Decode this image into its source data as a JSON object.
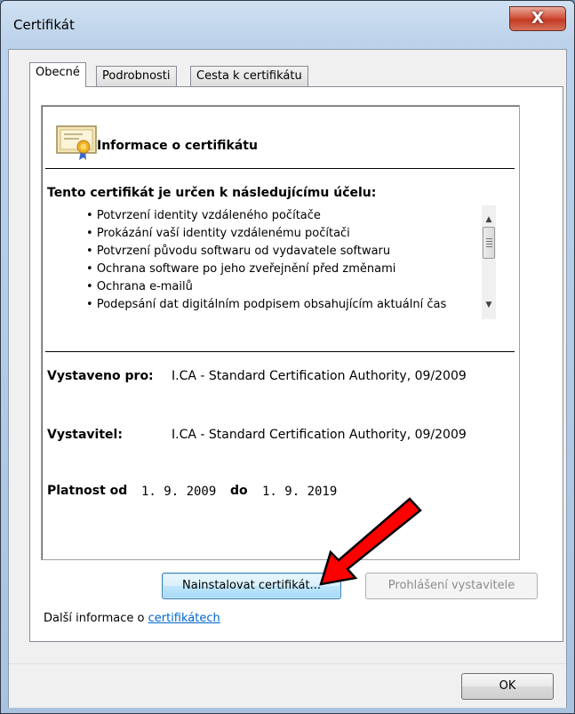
{
  "window": {
    "title": "Certifikát",
    "close_glyph": "X"
  },
  "tabs": [
    {
      "label": "Obecné",
      "active": true
    },
    {
      "label": "Podrobnosti",
      "active": false
    },
    {
      "label": "Cesta k certifikátu",
      "active": false
    }
  ],
  "cert": {
    "icon": "certificate-icon",
    "heading": "Informace o certifikátu",
    "purpose_title": "Tento certifikát je určen k následujícímu účelu:",
    "purposes": [
      "Potvrzení identity vzdáleného počítače",
      "Prokázání vaší identity vzdálenému počítači",
      "Potvrzení původu softwaru od vydavatele softwaru",
      "Ochrana software po jeho zveřejnění před změnami",
      "Ochrana e-mailů",
      "Podepsání dat digitálním podpisem obsahujícím aktuální čas"
    ],
    "issued_to_label": "Vystaveno pro:",
    "issued_to_value": "I.CA - Standard Certification Authority, 09/2009",
    "issuer_label": "Vystavitel:",
    "issuer_value": "I.CA - Standard Certification Authority, 09/2009",
    "valid_from_label": "Platnost od",
    "valid_from": "1. 9. 2009",
    "valid_to_label": "do",
    "valid_to": "1. 9. 2019"
  },
  "buttons": {
    "install": "Nainstalovat certifikát...",
    "issuer_statement": "Prohlášení vystavitele",
    "ok": "OK"
  },
  "more_info": {
    "prefix": "Další informace o ",
    "link": "certifikátech"
  },
  "colors": {
    "arrow": "#ff0000",
    "link": "#0066cc",
    "close": "#c23b22"
  }
}
